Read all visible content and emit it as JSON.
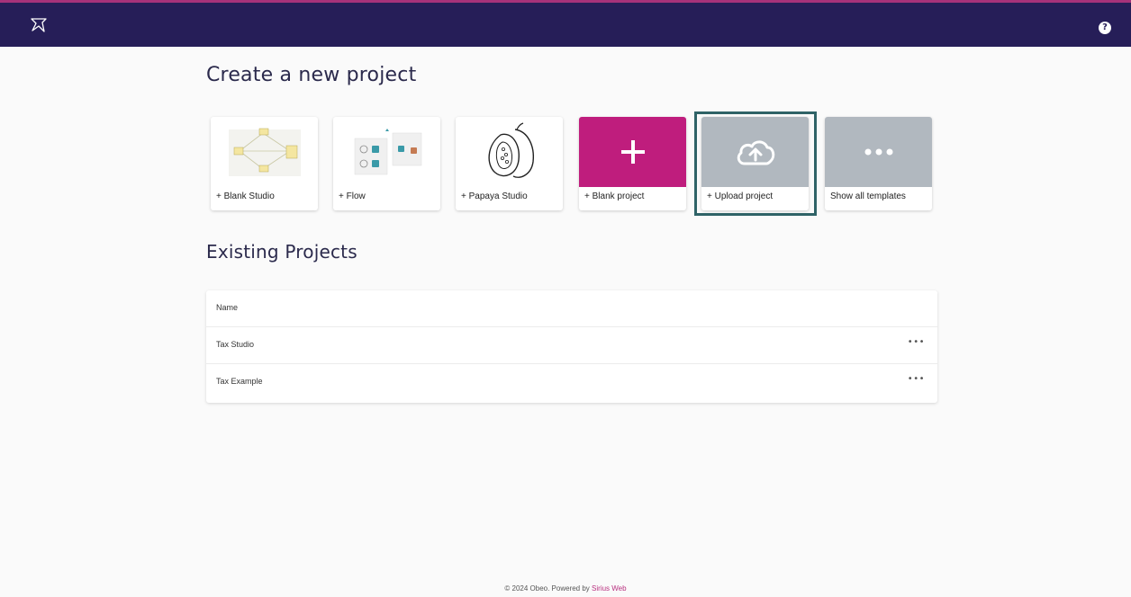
{
  "header": {
    "logo_icon": "sirius-star-icon",
    "help_glyph": "?"
  },
  "create": {
    "title": "Create a new project",
    "cards": [
      {
        "label": "+ Blank Studio",
        "thumb": "studio-diagram-thumbnail"
      },
      {
        "label": "+ Flow",
        "thumb": "flow-diagram-thumbnail"
      },
      {
        "label": "+ Papaya Studio",
        "thumb": "papaya-icon"
      },
      {
        "label": "+ Blank project",
        "thumb": "plus-icon",
        "color": "#bf1d7d"
      },
      {
        "label": "+ Upload project",
        "thumb": "cloud-upload-icon",
        "color": "#b1b8bf"
      },
      {
        "label": "Show all templates",
        "thumb": "more-horizontal-icon",
        "color": "#b1b8bf"
      }
    ]
  },
  "existing": {
    "title": "Existing Projects",
    "header": "Name",
    "rows": [
      {
        "name": "Tax Studio",
        "more": "•••"
      },
      {
        "name": "Tax Example",
        "more": "•••"
      }
    ]
  },
  "footer": {
    "text": "© 2024 Obeo. Powered by",
    "link": "Sirius Web"
  },
  "colors": {
    "topbar": "#261e58",
    "topbar_accent": "#a6327a",
    "blank_project": "#bf1d7d",
    "template_grey": "#b1b8bf",
    "highlight_border": "#2f6367",
    "link": "#b8307f"
  }
}
